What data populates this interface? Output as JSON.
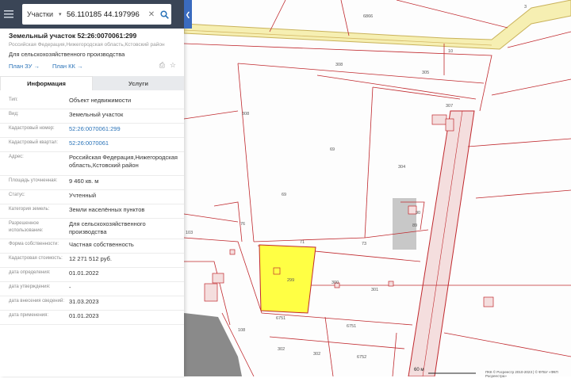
{
  "search": {
    "mode": "Участки",
    "query": "56.110185 44.197996"
  },
  "parcel": {
    "title": "Земельный участок 52:26:0070061:299",
    "address_short": "Российская Федерация,Нижегородская область,Кстовский район",
    "purpose": "Для сельскохозяйственного производства",
    "link_zu": "План ЗУ →",
    "link_kk": "План КК →"
  },
  "tabs": {
    "info": "Информация",
    "services": "Услуги"
  },
  "fields": [
    {
      "k": "Тип:",
      "v": "Объект недвижимости"
    },
    {
      "k": "Вид:",
      "v": "Земельный участок"
    },
    {
      "k": "Кадастровый номер:",
      "v": "52:26:0070061:299"
    },
    {
      "k": "Кадастровый квартал:",
      "v": "52:26:0070061"
    },
    {
      "k": "Адрес:",
      "v": "Российская Федерация,Нижегородская область,Кстовский район"
    },
    {
      "k": "Площадь уточненная:",
      "v": "9 460 кв. м"
    },
    {
      "k": "Статус:",
      "v": "Учтенный"
    },
    {
      "k": "Категория земель:",
      "v": "Земли населённых пунктов"
    },
    {
      "k": "Разрешенное использование:",
      "v": "Для сельскохозяйственного производства"
    },
    {
      "k": "Форма собственности:",
      "v": "Частная собственность"
    },
    {
      "k": "Кадастровая стоимость:",
      "v": "12 271 512 руб."
    },
    {
      "k": "дата определения:",
      "v": "01.01.2022"
    },
    {
      "k": "дата утверждения:",
      "v": "-"
    },
    {
      "k": "дата внесения сведений:",
      "v": "31.03.2023"
    },
    {
      "k": "дата применения:",
      "v": "01.01.2023"
    }
  ],
  "map": {
    "labels": [
      "6866",
      "308",
      "305",
      "307",
      "308",
      "69",
      "304",
      "69",
      "76",
      "103",
      "71",
      "73",
      "90",
      "89",
      "299",
      "300",
      "301",
      "108",
      "6751",
      "6751",
      "302",
      "302",
      "6752",
      "10",
      "3"
    ],
    "scale": "60 м",
    "copyright": "ПКК © Росреестр 2010-2023 | © ФГБУ «ФКП Росреестра»"
  },
  "colors": {
    "header_bg": "#3a4556",
    "accent": "#3a6bbf",
    "link": "#2a73b8",
    "selected_parcel": "#ffff44",
    "parcel_line": "#c0282d"
  }
}
